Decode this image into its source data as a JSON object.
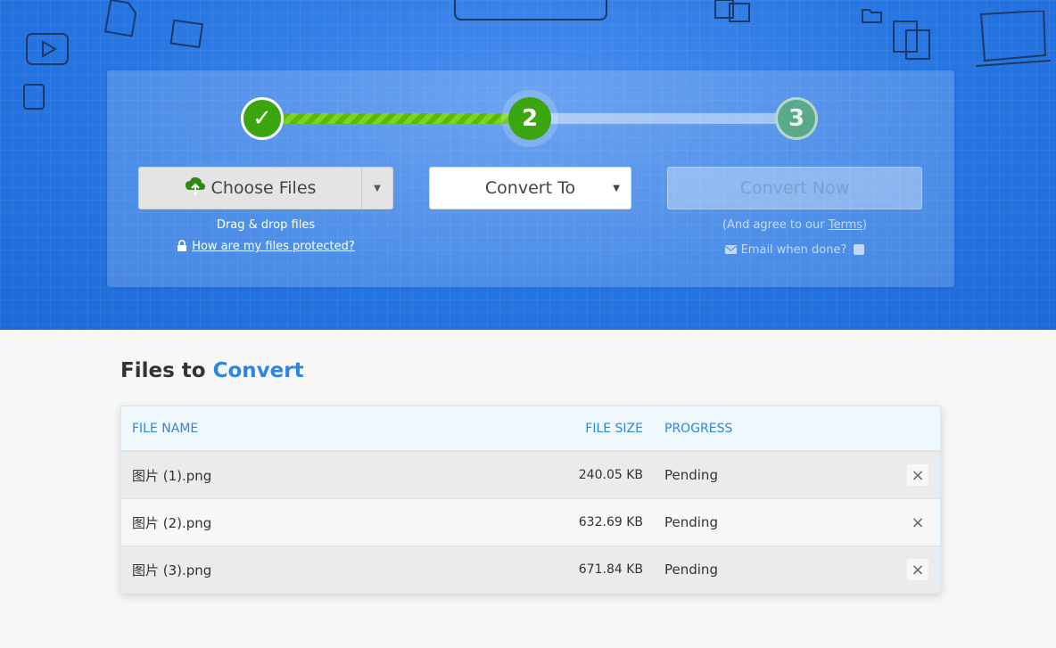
{
  "steps": {
    "step1_label": "✓",
    "step2_label": "2",
    "step3_label": "3"
  },
  "upload": {
    "choose_label": "Choose Files",
    "drag_text": "Drag & drop files",
    "protect_link": "How are my files protected?"
  },
  "convert_to": {
    "label": "Convert To"
  },
  "convert_now": {
    "label": "Convert Now",
    "agree_prefix": "(And agree to our ",
    "terms_link": "Terms",
    "agree_suffix": ")",
    "email_label": "Email when done?"
  },
  "files": {
    "title_prefix": "Files to ",
    "title_accent": "Convert",
    "columns": {
      "name": "FILE NAME",
      "size": "FILE SIZE",
      "progress": "PROGRESS"
    },
    "rows": [
      {
        "name": "图片 (1).png",
        "size": "240.05 KB",
        "progress": "Pending",
        "remove": "×"
      },
      {
        "name": "图片 (2).png",
        "size": "632.69 KB",
        "progress": "Pending",
        "remove": "×"
      },
      {
        "name": "图片 (3).png",
        "size": "671.84 KB",
        "progress": "Pending",
        "remove": "×"
      }
    ]
  },
  "colors": {
    "hero_blue": "#2a7ae6",
    "step_green": "#3aa50e",
    "accent_blue": "#2d86e0"
  }
}
